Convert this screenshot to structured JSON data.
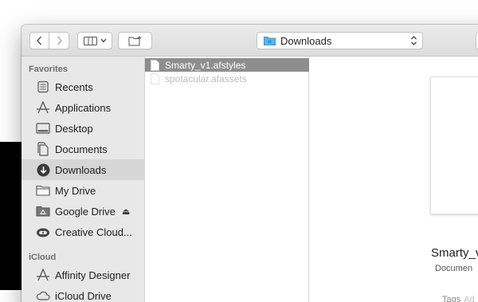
{
  "toolbar": {
    "back_icon": "chevron-left-icon",
    "forward_icon": "chevron-right-icon",
    "view_icon": "columns-view-icon",
    "new_folder_icon": "new-folder-icon",
    "location": "Downloads",
    "location_icon": "downloads-folder-icon"
  },
  "sidebar": {
    "favorites_header": "Favorites",
    "favorites": [
      {
        "label": "Recents",
        "icon": "recents-icon"
      },
      {
        "label": "Applications",
        "icon": "applications-icon"
      },
      {
        "label": "Desktop",
        "icon": "desktop-icon"
      },
      {
        "label": "Documents",
        "icon": "documents-icon"
      },
      {
        "label": "Downloads",
        "icon": "downloads-icon",
        "selected": true
      },
      {
        "label": "My Drive",
        "icon": "folder-icon"
      },
      {
        "label": "Google Drive",
        "icon": "google-drive-icon",
        "eject": "⏏"
      },
      {
        "label": "Creative Cloud...",
        "icon": "creative-cloud-icon"
      }
    ],
    "icloud_header": "iCloud",
    "icloud": [
      {
        "label": "Affinity Designer",
        "icon": "affinity-designer-icon"
      },
      {
        "label": "iCloud Drive",
        "icon": "icloud-icon"
      }
    ]
  },
  "files": [
    {
      "name": "Smarty_v1.afstyles",
      "selected": true
    },
    {
      "name": "spotacular.afassets",
      "selected": false
    }
  ],
  "preview": {
    "name": "Smarty_v",
    "kind": "Documen",
    "tags_label": "Tags",
    "tags_placeholder": "Ad"
  },
  "colors": {
    "selection_gray": "#8e8e8e",
    "sidebar_bg": "#e8e8e8",
    "accent_blue": "#2f9bdb"
  }
}
